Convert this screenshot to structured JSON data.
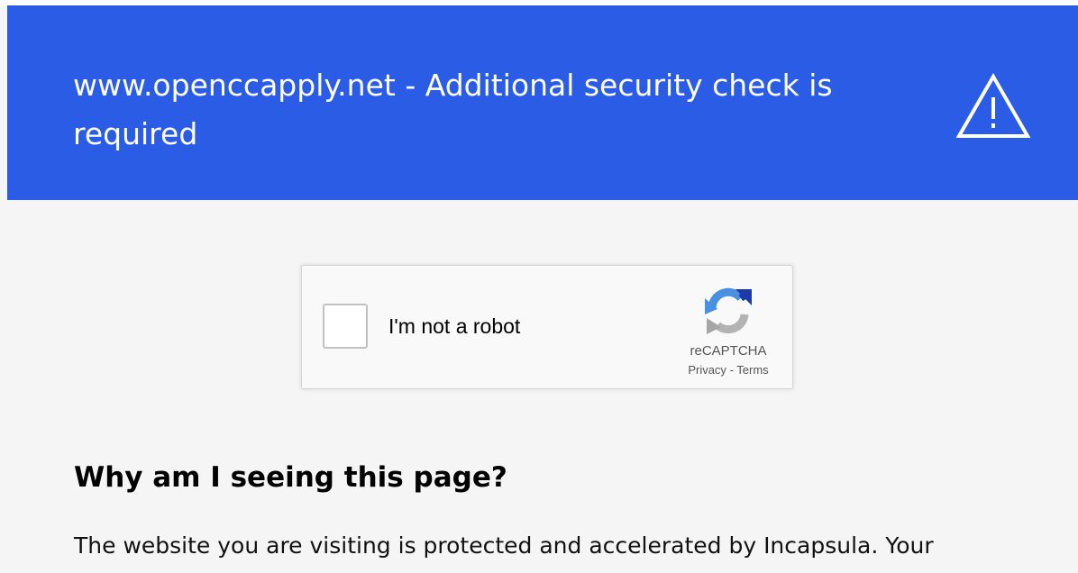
{
  "header": {
    "title": "www.openccapply.net - Additional security check is required",
    "background_color": "#2a5ce6",
    "icon": "warning-icon"
  },
  "captcha": {
    "checkbox_label": "I'm not a robot",
    "checked": false,
    "brand": "reCAPTCHA",
    "privacy_link": "Privacy",
    "separator": "-",
    "terms_link": "Terms",
    "icon": "recaptcha-logo-icon"
  },
  "content": {
    "heading": "Why am I seeing this page?",
    "paragraph": "The website you are visiting is protected and accelerated by Incapsula. Your"
  }
}
